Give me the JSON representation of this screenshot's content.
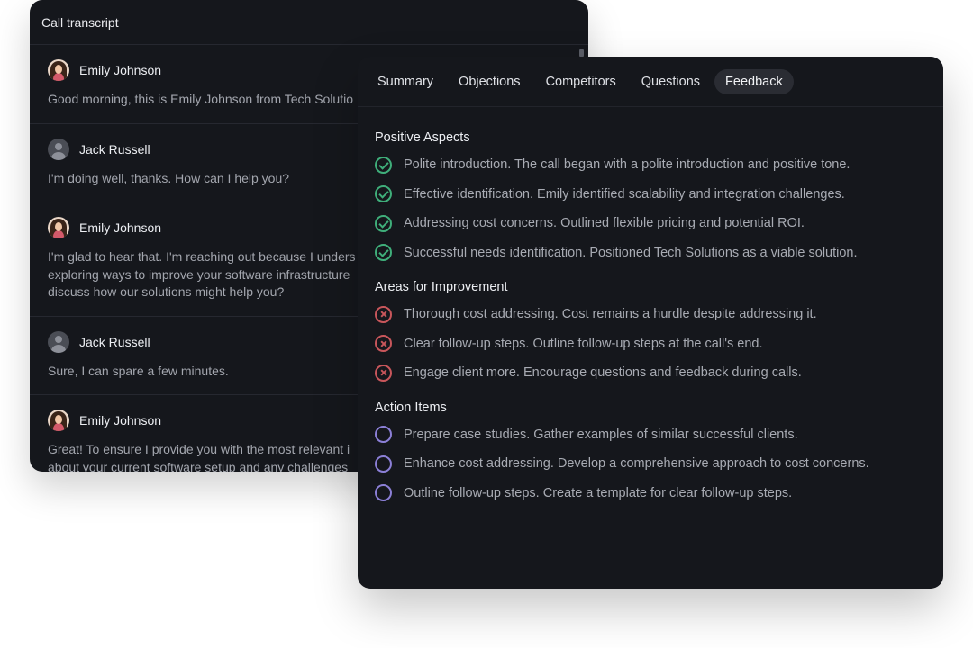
{
  "transcript": {
    "title": "Call transcript",
    "messages": [
      {
        "speaker": "Emily Johnson",
        "avatar": "emily",
        "text": "Good morning, this is Emily Johnson from Tech Solutio"
      },
      {
        "speaker": "Jack Russell",
        "avatar": "jack",
        "text": "I'm doing well, thanks. How can I help you?"
      },
      {
        "speaker": "Emily Johnson",
        "avatar": "emily",
        "text": "I'm glad to hear that. I'm reaching out because I unders\nexploring ways to improve your software infrastructure\ndiscuss how our solutions might help you?"
      },
      {
        "speaker": "Jack Russell",
        "avatar": "jack",
        "text": "Sure, I can spare a few minutes."
      },
      {
        "speaker": "Emily Johnson",
        "avatar": "emily",
        "text": "Great! To ensure I provide you with the most relevant i\nabout your current software setup and any challenges"
      }
    ]
  },
  "feedback": {
    "tabs": [
      {
        "label": "Summary",
        "active": false
      },
      {
        "label": "Objections",
        "active": false
      },
      {
        "label": "Competitors",
        "active": false
      },
      {
        "label": "Questions",
        "active": false
      },
      {
        "label": "Feedback",
        "active": true
      }
    ],
    "sections": [
      {
        "title": "Positive Aspects",
        "icon": "check-circle-icon",
        "color": "#3fae7a",
        "items": [
          "Polite introduction. The call began with a polite introduction and positive tone.",
          "Effective identification. Emily identified scalability and integration challenges.",
          "Addressing cost concerns. Outlined flexible pricing and potential ROI.",
          "Successful needs identification. Positioned Tech Solutions as a viable solution."
        ]
      },
      {
        "title": "Areas for Improvement",
        "icon": "x-circle-icon",
        "color": "#c8565b",
        "items": [
          "Thorough cost addressing. Cost remains a hurdle despite addressing it.",
          "Clear follow-up steps. Outline follow-up steps at the call's end.",
          "Engage client more. Encourage questions and feedback during calls."
        ]
      },
      {
        "title": "Action Items",
        "icon": "empty-circle-icon",
        "color": "#8b7fd6",
        "items": [
          "Prepare case studies. Gather examples of similar successful clients.",
          "Enhance cost addressing. Develop a comprehensive approach to cost concerns.",
          "Outline follow-up steps. Create a template for clear follow-up steps."
        ]
      }
    ]
  }
}
